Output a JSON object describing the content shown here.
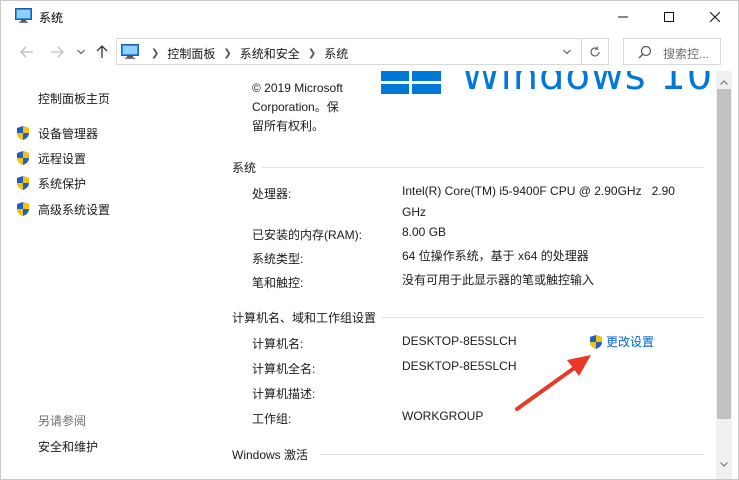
{
  "window": {
    "title": "系统",
    "icon": "computer-monitor-icon"
  },
  "titlebar": {
    "minimize_icon": "minimize-icon",
    "maximize_icon": "maximize-icon",
    "close_icon": "close-icon"
  },
  "nav": {
    "back_icon": "arrow-left-icon",
    "forward_icon": "arrow-right-icon",
    "recent_icon": "chevron-down-icon",
    "up_icon": "arrow-up-icon",
    "breadcrumbs": [
      "控制面板",
      "系统和安全",
      "系统"
    ],
    "refresh_icon": "refresh-icon",
    "search_placeholder": "搜索控..."
  },
  "sidebar": {
    "home": "控制面板主页",
    "items": [
      {
        "label": "设备管理器",
        "icon": "shield-icon"
      },
      {
        "label": "远程设置",
        "icon": "shield-icon"
      },
      {
        "label": "系统保护",
        "icon": "shield-icon"
      },
      {
        "label": "高级系统设置",
        "icon": "shield-icon"
      }
    ],
    "see_also": "另请参阅",
    "security_link": "安全和维护"
  },
  "edition": {
    "copyright_lines": [
      "© 2019 Microsoft",
      "Corporation。保",
      "留所有权利。"
    ],
    "logo_text": "Windows 10"
  },
  "system": {
    "title": "系统",
    "rows": [
      {
        "label": "处理器:",
        "value": "Intel(R) Core(TM) i5-9400F CPU @ 2.90GHz   2.90",
        "value2": "GHz"
      },
      {
        "label": "已安装的内存(RAM):",
        "value": "8.00 GB"
      },
      {
        "label": "系统类型:",
        "value": "64 位操作系统，基于 x64 的处理器"
      },
      {
        "label": "笔和触控:",
        "value": "没有可用于此显示器的笔或触控输入"
      }
    ]
  },
  "computer": {
    "title": "计算机名、域和工作组设置",
    "rows": [
      {
        "label": "计算机名:",
        "value": "DESKTOP-8E5SLCH"
      },
      {
        "label": "计算机全名:",
        "value": "DESKTOP-8E5SLCH"
      },
      {
        "label": "计算机描述:",
        "value": ""
      },
      {
        "label": "工作组:",
        "value": "WORKGROUP"
      }
    ],
    "change_link": "更改设置"
  },
  "activation": {
    "title": "Windows 激活"
  },
  "colors": {
    "link": "#0066cc",
    "windows_blue": "#0078d7",
    "arrow_red": "#e8382a",
    "shield_blue": "#1f5fbf",
    "shield_yellow": "#f4c20d"
  }
}
